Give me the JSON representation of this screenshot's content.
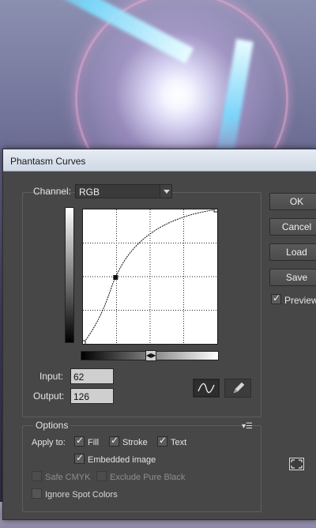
{
  "dialog": {
    "title": "Phantasm Curves"
  },
  "channel": {
    "label": "Channel:",
    "value": "RGB"
  },
  "curve": {
    "selected_point": {
      "input": 62,
      "output": 126
    }
  },
  "inputs": {
    "input_label": "Input:",
    "input_value": "62",
    "output_label": "Output:",
    "output_value": "126"
  },
  "buttons": {
    "ok": "OK",
    "cancel": "Cancel",
    "load": "Load",
    "save": "Save"
  },
  "preview": {
    "label": "Preview",
    "checked": true
  },
  "options": {
    "title": "Options",
    "apply_to_label": "Apply to:",
    "fill_label": "Fill",
    "stroke_label": "Stroke",
    "text_label": "Text",
    "embedded_label": "Embedded image",
    "safe_cmyk_label": "Safe CMYK",
    "exclude_black_label": "Exclude Pure Black",
    "ignore_spot_label": "Ignore Spot Colors"
  },
  "icons": {
    "curve_tool": "curve-icon",
    "pencil_tool": "pencil-icon",
    "options_menu": "panel-menu-icon",
    "expand": "expand-icon"
  },
  "colors": {
    "dialog_bg": "#474747",
    "titlebar_bg": "#dbe3ee"
  }
}
